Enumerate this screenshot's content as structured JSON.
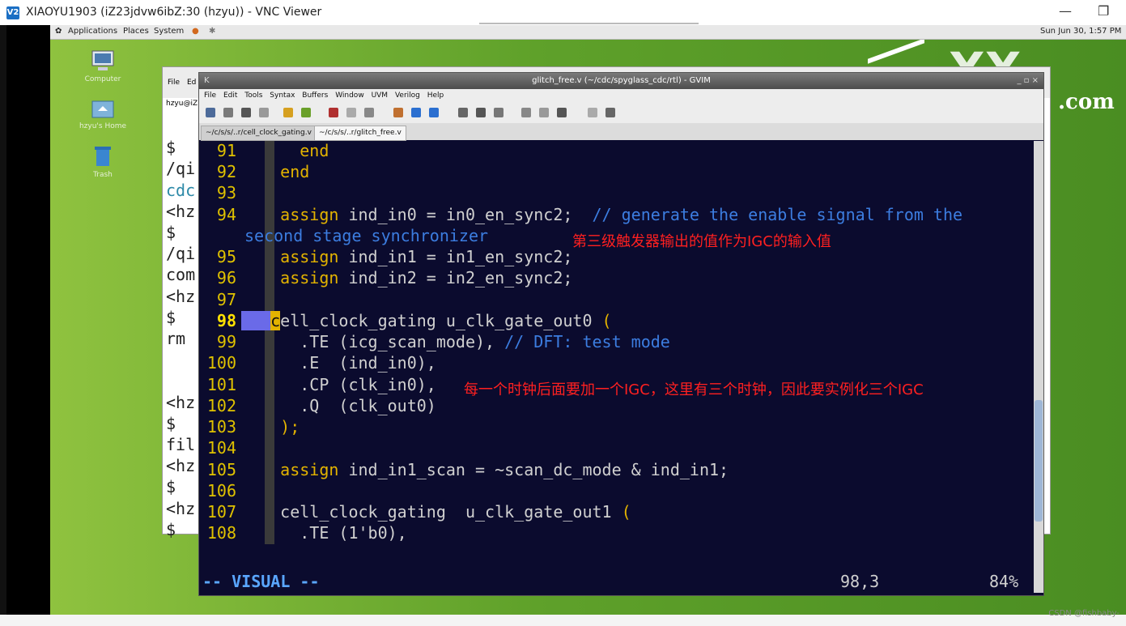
{
  "vnc": {
    "logo": "V2",
    "title": "XIAOYU1903 (iZ23jdvw6ibZ:30 (hzyu)) - VNC Viewer",
    "minimize": "—",
    "restore": "❐"
  },
  "gnome_panel": {
    "menus": [
      "Applications",
      "Places",
      "System"
    ],
    "clock": "Sun Jun 30,  1:57 PM"
  },
  "desktop": {
    "icons": [
      {
        "label": "Computer"
      },
      {
        "label": "hzyu's Home"
      },
      {
        "label": "Trash"
      }
    ],
    "brand_text": "XX",
    "brand_sub": ".com"
  },
  "terminal": {
    "menu": [
      "File",
      "Ed"
    ],
    "host_prefix": "hzyu@iZ",
    "lines": [
      "$",
      "/qi",
      "cdc",
      "<hz",
      "$",
      "/qi",
      "com",
      "<hz",
      "$",
      "rm",
      "",
      "",
      "<hz",
      "$",
      "fil",
      "<hz",
      "$",
      "<hz",
      "$"
    ]
  },
  "gvim": {
    "title": "glitch_free.v (~/cdc/spyglass_cdc/rtl) - GVIM",
    "menu": [
      "File",
      "Edit",
      "Tools",
      "Syntax",
      "Buffers",
      "Window",
      "UVM",
      "Verilog",
      "Help"
    ],
    "tabs": [
      "~/c/s/s/..r/cell_clock_gating.v",
      "~/c/s/s/..r/glitch_free.v"
    ],
    "active_tab": 1,
    "lines": [
      {
        "n": "91",
        "pre": "      ",
        "kw": "end",
        "rest": ""
      },
      {
        "n": "92",
        "pre": "    ",
        "kw": "end",
        "rest": ""
      },
      {
        "n": "93",
        "pre": "",
        "kw": "",
        "rest": ""
      },
      {
        "n": "94",
        "pre": "    ",
        "kw": "assign",
        "rest": " ind_in0 = in0_en_sync2;  ",
        "comment": "// generate the enable signal from the"
      },
      {
        "n": "",
        "pre": "",
        "kw": "",
        "rest": "",
        "comment": "second stage synchronizer"
      },
      {
        "n": "95",
        "pre": "    ",
        "kw": "assign",
        "rest": " ind_in1 = in1_en_sync2;"
      },
      {
        "n": "96",
        "pre": "    ",
        "kw": "assign",
        "rest": " ind_in2 = in2_en_sync2;"
      },
      {
        "n": "97",
        "pre": "",
        "kw": "",
        "rest": ""
      },
      {
        "n": "98",
        "pre": "",
        "kw": "",
        "rest": "ell_clock_gating u_clk_gate_out0 ",
        "sel": "c",
        "paren": "("
      },
      {
        "n": "99",
        "pre": "      ",
        "kw": "",
        "rest": ".TE (icg_scan_mode), ",
        "comment": "// DFT: test mode"
      },
      {
        "n": "100",
        "pre": "      ",
        "kw": "",
        "rest": ".E  (ind_in0),"
      },
      {
        "n": "101",
        "pre": "      ",
        "kw": "",
        "rest": ".CP (clk_in0),"
      },
      {
        "n": "102",
        "pre": "      ",
        "kw": "",
        "rest": ".Q  (clk_out0)"
      },
      {
        "n": "103",
        "pre": "    ",
        "kw": "",
        "rest": "",
        "paren": ");"
      },
      {
        "n": "104",
        "pre": "",
        "kw": "",
        "rest": ""
      },
      {
        "n": "105",
        "pre": "    ",
        "kw": "assign",
        "rest": " ind_in1_scan = ~scan_dc_mode & ind_in1;"
      },
      {
        "n": "106",
        "pre": "",
        "kw": "",
        "rest": ""
      },
      {
        "n": "107",
        "pre": "    ",
        "kw": "",
        "rest": "cell_clock_gating  u_clk_gate_out1 ",
        "paren": "("
      },
      {
        "n": "108",
        "pre": "      ",
        "kw": "",
        "rest": ".TE (1'b0),"
      }
    ],
    "status_mode": "-- VISUAL --",
    "status_pos": "98,3",
    "status_pct": "84%"
  },
  "annotations": {
    "a1": "第三级触发器输出的值作为IGC的输入值",
    "a2": "每一个时钟后面要加一个IGC，这里有三个时钟，因此要实例化三个IGC"
  },
  "watermark": "CSDN @fishbaby-"
}
